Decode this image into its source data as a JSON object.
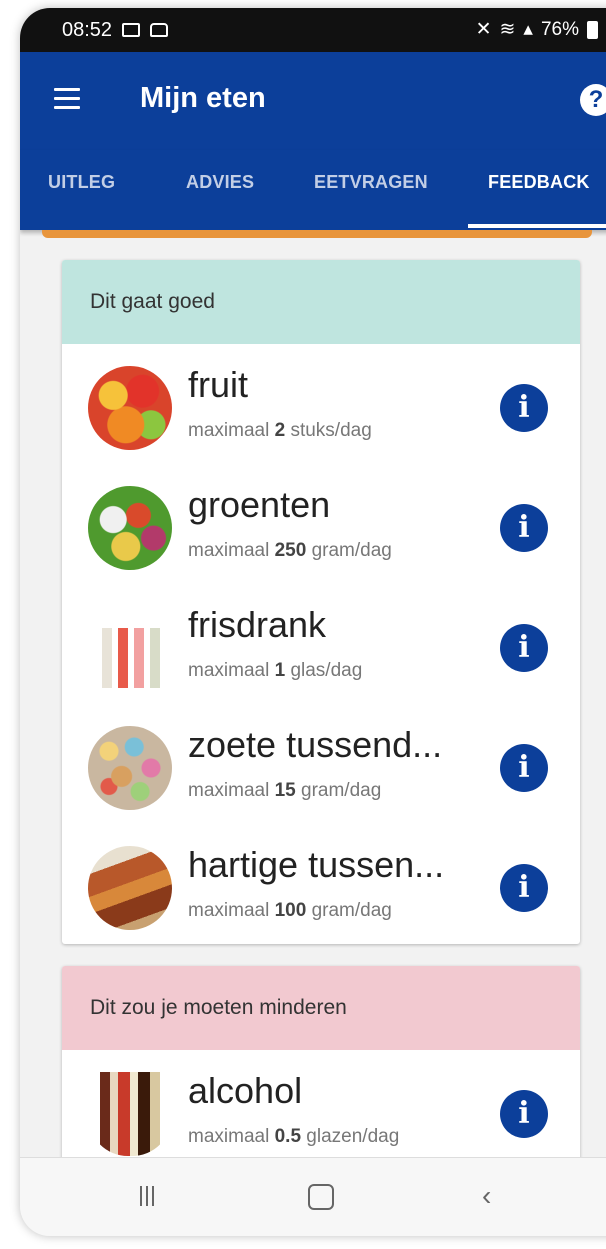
{
  "status_bar": {
    "time": "08:52",
    "battery": "76%"
  },
  "app_bar": {
    "title": "Mijn eten",
    "help_label": "?"
  },
  "tabs": [
    {
      "label": "UITLEG",
      "active": false
    },
    {
      "label": "ADVIES",
      "active": false
    },
    {
      "label": "EETVRAGEN",
      "active": false
    },
    {
      "label": "FEEDBACK",
      "active": true
    }
  ],
  "sections": [
    {
      "header": "Dit gaat goed",
      "color": "#bfe5df",
      "items": [
        {
          "name": "fruit",
          "prefix": "maximaal",
          "amount": "2",
          "unit": "stuks/dag",
          "image": "fruit-image"
        },
        {
          "name": "groenten",
          "prefix": "maximaal",
          "amount": "250",
          "unit": "gram/dag",
          "image": "vegetables-image"
        },
        {
          "name": "frisdrank",
          "prefix": "maximaal",
          "amount": "1",
          "unit": "glas/dag",
          "image": "soda-bottles-image"
        },
        {
          "name": "zoete tussend...",
          "prefix": "maximaal",
          "amount": "15",
          "unit": "gram/dag",
          "image": "candy-image"
        },
        {
          "name": "hartige tussen...",
          "prefix": "maximaal",
          "amount": "100",
          "unit": "gram/dag",
          "image": "savory-snacks-image"
        }
      ]
    },
    {
      "header": "Dit zou je moeten minderen",
      "color": "#f2c9d0",
      "items": [
        {
          "name": "alcohol",
          "prefix": "maximaal",
          "amount": "0.5",
          "unit": "glazen/dag",
          "image": "alcohol-bottles-image"
        }
      ]
    }
  ],
  "info_label": "i",
  "colors": {
    "primary": "#0c3f9a",
    "accent": "#e8953c"
  }
}
